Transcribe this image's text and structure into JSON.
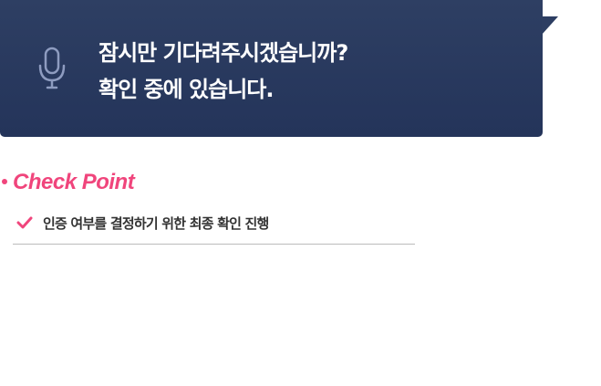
{
  "status": {
    "line1": "잠시만 기다려주시겠습니까?",
    "line2": "확인 중에 있습니다.",
    "icon": "microphone-icon",
    "bg_color": "#2b3b5f"
  },
  "checkpoint": {
    "title": "Check Point",
    "accent_color": "#f0457c",
    "items": [
      {
        "icon": "check-icon",
        "text": "인증 여부를 결정하기 위한 최종 확인 진행"
      }
    ]
  }
}
